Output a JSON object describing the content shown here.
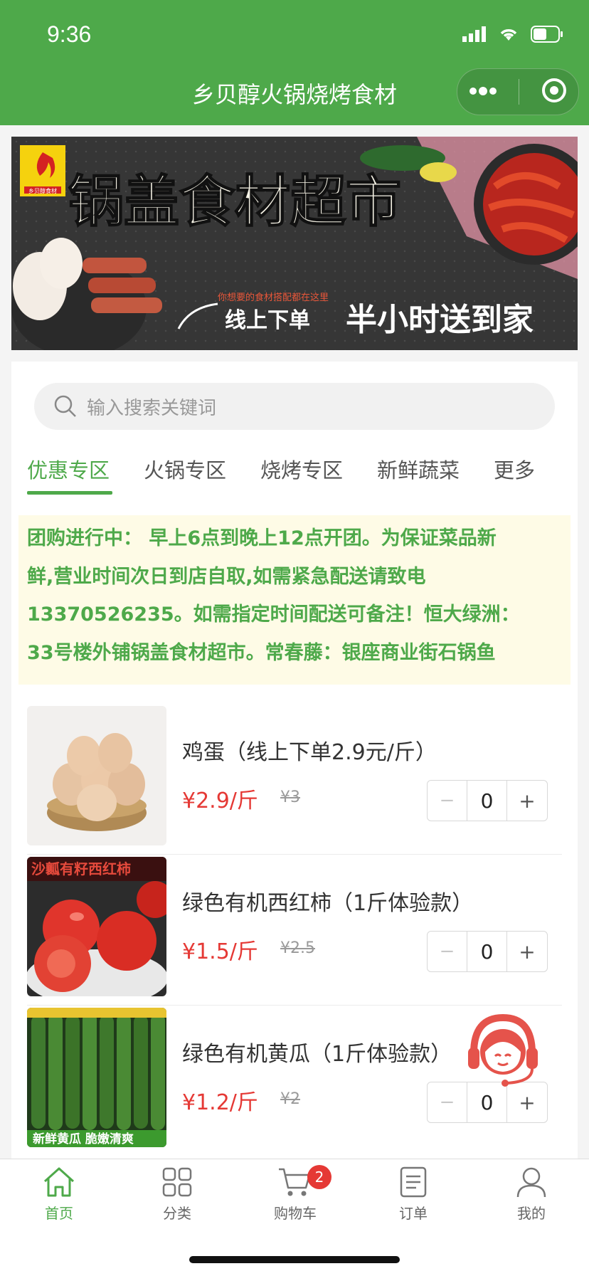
{
  "status_bar": {
    "time": "9:36"
  },
  "header": {
    "title": "乡贝醇火锅烧烤食材",
    "more_icon": "more-dots-icon",
    "close_icon": "target-circle-icon"
  },
  "banner": {
    "logo_text": "乡贝醇食材",
    "headline": "锅盖食材超市",
    "tagline_small": "你想要的食材搭配都在这里",
    "tagline_left": "线上下单",
    "tagline_right": "半小时送到家"
  },
  "search": {
    "placeholder": "输入搜索关键词"
  },
  "tabs": [
    {
      "label": "优惠专区",
      "active": true
    },
    {
      "label": "火锅专区",
      "active": false
    },
    {
      "label": "烧烤专区",
      "active": false
    },
    {
      "label": "新鲜蔬菜",
      "active": false
    },
    {
      "label": "更多",
      "active": false
    }
  ],
  "notice": {
    "line1": "团购进行中： 早上6点到晚上12点开团。为保证菜品新",
    "line2": "鲜,营业时间次日到店自取,如需紧急配送请致电",
    "line3": "13370526235。如需指定时间配送可备注！恒大绿洲：",
    "line4": "33号楼外铺锅盖食材超市。常春藤：银座商业街石锅鱼"
  },
  "products": [
    {
      "name": "鸡蛋（线上下单2.9元/斤）",
      "price": "¥2.9/斤",
      "original_price": "¥3",
      "qty": "0",
      "image_caption": ""
    },
    {
      "name": "绿色有机西红柿（1斤体验款）",
      "price": "¥1.5/斤",
      "original_price": "¥2.5",
      "qty": "0",
      "image_caption": "沙瓤有籽西红柿"
    },
    {
      "name": "绿色有机黄瓜（1斤体验款）",
      "price": "¥1.2/斤",
      "original_price": "¥2",
      "qty": "0",
      "image_caption": "新鲜黄瓜 脆嫩清爽"
    }
  ],
  "stepper": {
    "minus": "−",
    "plus": "+"
  },
  "tabbar": [
    {
      "label": "首页",
      "icon": "home-icon",
      "active": true
    },
    {
      "label": "分类",
      "icon": "category-grid-icon",
      "active": false
    },
    {
      "label": "购物车",
      "icon": "cart-icon",
      "active": false,
      "badge": "2"
    },
    {
      "label": "订单",
      "icon": "order-list-icon",
      "active": false
    },
    {
      "label": "我的",
      "icon": "user-icon",
      "active": false
    }
  ],
  "colors": {
    "brand": "#4ea94a",
    "price": "#e53935",
    "notice_bg": "#fefbe6"
  }
}
